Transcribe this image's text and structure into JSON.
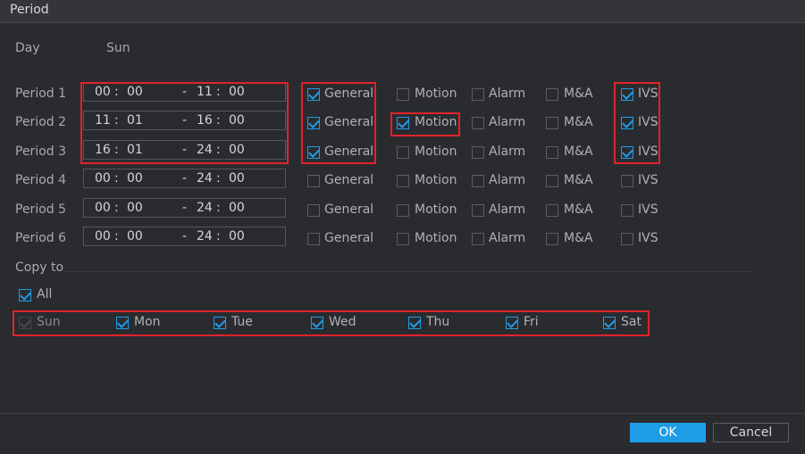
{
  "window": {
    "title": "Period"
  },
  "day": {
    "label": "Day",
    "value": "Sun"
  },
  "periods": [
    {
      "label": "Period 1",
      "start_h": "00",
      "start_m": "00",
      "end_h": "11",
      "end_m": "00",
      "general": true,
      "motion": false,
      "alarm": false,
      "ma": false,
      "ivs": true
    },
    {
      "label": "Period 2",
      "start_h": "11",
      "start_m": "01",
      "end_h": "16",
      "end_m": "00",
      "general": true,
      "motion": true,
      "alarm": false,
      "ma": false,
      "ivs": true
    },
    {
      "label": "Period 3",
      "start_h": "16",
      "start_m": "01",
      "end_h": "24",
      "end_m": "00",
      "general": true,
      "motion": false,
      "alarm": false,
      "ma": false,
      "ivs": true
    },
    {
      "label": "Period 4",
      "start_h": "00",
      "start_m": "00",
      "end_h": "24",
      "end_m": "00",
      "general": false,
      "motion": false,
      "alarm": false,
      "ma": false,
      "ivs": false
    },
    {
      "label": "Period 5",
      "start_h": "00",
      "start_m": "00",
      "end_h": "24",
      "end_m": "00",
      "general": false,
      "motion": false,
      "alarm": false,
      "ma": false,
      "ivs": false
    },
    {
      "label": "Period 6",
      "start_h": "00",
      "start_m": "00",
      "end_h": "24",
      "end_m": "00",
      "general": false,
      "motion": false,
      "alarm": false,
      "ma": false,
      "ivs": false
    }
  ],
  "event_labels": {
    "general": "General",
    "motion": "Motion",
    "alarm": "Alarm",
    "ma": "M&A",
    "ivs": "IVS"
  },
  "time_sep": {
    "colon": ":",
    "dash": "-"
  },
  "copy_to": {
    "label": "Copy to",
    "all_label": "All",
    "all_checked": true,
    "days": [
      {
        "label": "Sun",
        "checked": true,
        "disabled": true
      },
      {
        "label": "Mon",
        "checked": true,
        "disabled": false
      },
      {
        "label": "Tue",
        "checked": true,
        "disabled": false
      },
      {
        "label": "Wed",
        "checked": true,
        "disabled": false
      },
      {
        "label": "Thu",
        "checked": true,
        "disabled": false
      },
      {
        "label": "Fri",
        "checked": true,
        "disabled": false
      },
      {
        "label": "Sat",
        "checked": true,
        "disabled": false
      }
    ]
  },
  "buttons": {
    "ok": "OK",
    "cancel": "Cancel"
  },
  "colors": {
    "accent": "#1e9de6",
    "highlight": "#e0242a",
    "background": "#2a2b2f"
  }
}
